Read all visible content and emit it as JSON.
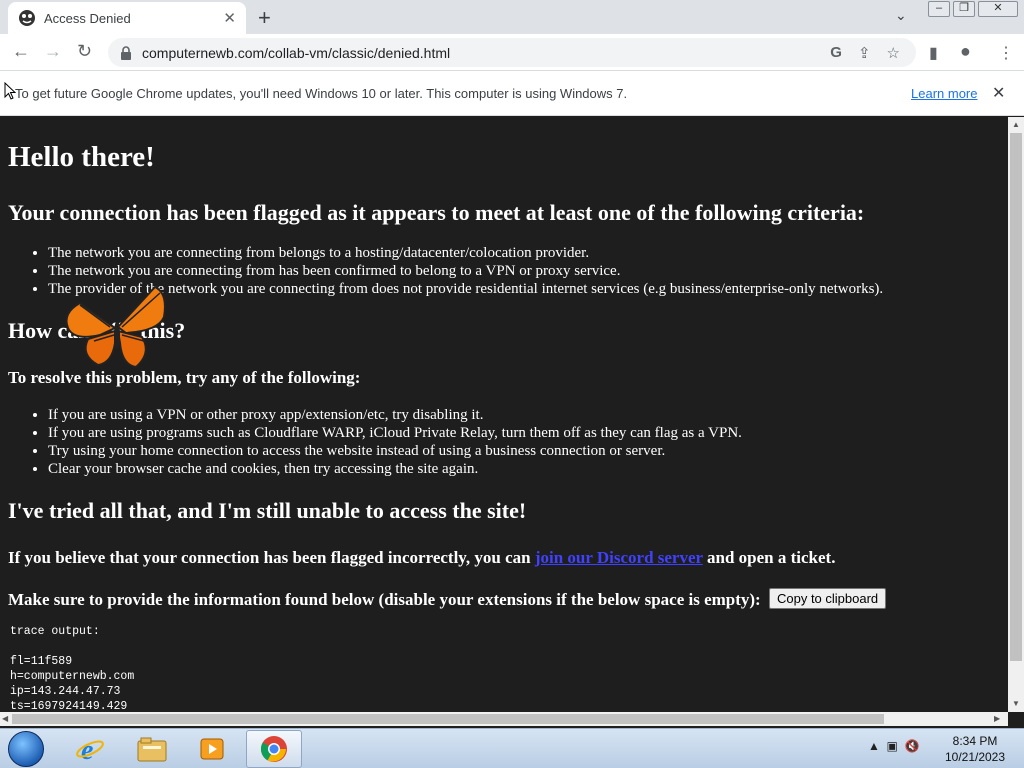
{
  "tab": {
    "title": "Access Denied"
  },
  "omnibox": {
    "url": "computernewb.com/collab-vm/classic/denied.html"
  },
  "infobar": {
    "message": "To get future Google Chrome updates, you'll need Windows 10 or later. This computer is using Windows 7.",
    "learn_more": "Learn more"
  },
  "page": {
    "h1": "Hello there!",
    "h2_flagged": "Your connection has been flagged as it appears to meet at least one of the following criteria:",
    "criteria": [
      "The network you are connecting from belongs to a hosting/datacenter/colocation provider.",
      "The network you are connecting from has been confirmed to belong to a VPN or proxy service.",
      "The provider of the network you are connecting from does not provide residential internet services (e.g business/enterprise-only networks)."
    ],
    "h2_how": "How can I fix this?",
    "h3_resolve": "To resolve this problem, try any of the following:",
    "fixes": [
      "If you are using a VPN or other proxy app/extension/etc, try disabling it.",
      "If you are using programs such as Cloudflare WARP, iCloud Private Relay, turn them off as they can flag as a VPN.",
      "Try using your home connection to access the website instead of using a business connection or server.",
      "Clear your browser cache and cookies, then try accessing the site again."
    ],
    "h2_tried": "I've tried all that, and I'm still unable to access the site!",
    "incorrect_prefix": "If you believe that your connection has been flagged incorrectly, you can",
    "discord_link": "join our Discord server",
    "incorrect_suffix": "and open a ticket.",
    "provide_info": "Make sure to provide the information found below (disable your extensions if the below space is empty):",
    "copy_button": "Copy to clipboard",
    "trace": "trace output:\n\nfl=11f589\nh=computernewb.com\nip=143.244.47.73\nts=1697924149.429"
  },
  "clock": {
    "time": "8:34 PM",
    "date": "10/21/2023"
  },
  "colors": {
    "page_bg": "#1e1e1e",
    "link": "#4040ff",
    "chrome_frame": "#dee1e6"
  }
}
